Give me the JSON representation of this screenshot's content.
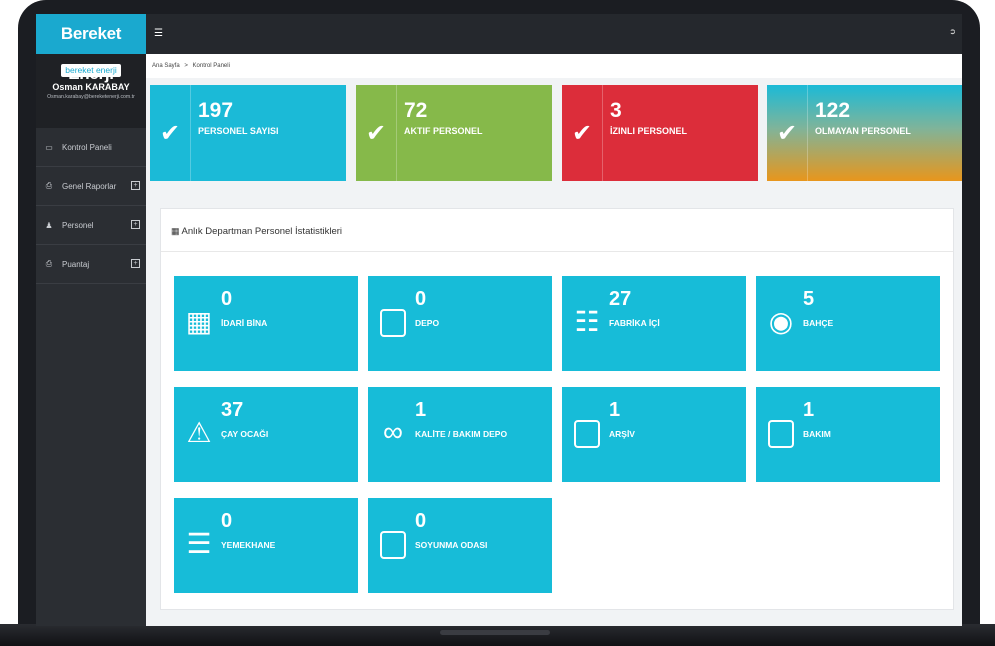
{
  "app": {
    "brand": "Bereket Enerji",
    "logo_text": "bereket enerji"
  },
  "user": {
    "name": "Osman KARABAY",
    "email": "Osman.karabay@bereketenerji.com.tr"
  },
  "sidebar": {
    "items": [
      {
        "label": "Kontrol Paneli",
        "icon": "monitor-icon",
        "expandable": false
      },
      {
        "label": "Genel Raporlar",
        "icon": "print-icon",
        "expandable": true
      },
      {
        "label": "Personel",
        "icon": "user-icon",
        "expandable": true
      },
      {
        "label": "Puantaj",
        "icon": "print-icon",
        "expandable": true
      }
    ]
  },
  "topbar": {
    "menu_icon": "hamburger-icon",
    "logout_icon": "logout-icon"
  },
  "breadcrumb": {
    "home": "Ana Sayfa",
    "separator": ">",
    "current": "Kontrol Paneli"
  },
  "stats": [
    {
      "value": "197",
      "label": "PERSONEL SAYISI",
      "color": "#1bbad7",
      "icon": "broken-link-icon"
    },
    {
      "value": "72",
      "label": "AKTIF PERSONEL",
      "color": "#86b94a",
      "icon": "broken-link-icon"
    },
    {
      "value": "3",
      "label": "İZINLI PERSONEL",
      "color": "#dc2d3a",
      "icon": "broken-link-icon"
    },
    {
      "value": "122",
      "label": "OLMAYAN PERSONEL",
      "color": "#e8961c",
      "icon": "broken-link-icon"
    }
  ],
  "panel": {
    "title": "Anlık Departman Personel İstatistikleri",
    "title_icon": "building-icon"
  },
  "departments": [
    {
      "value": "0",
      "label": "İDARİ BİNA",
      "icon": "building-icon"
    },
    {
      "value": "0",
      "label": "DEPO",
      "icon": "box-icon"
    },
    {
      "value": "27",
      "label": "FABRİKA İÇİ",
      "icon": "calendar-icon"
    },
    {
      "value": "5",
      "label": "BAHÇE",
      "icon": "globe-icon"
    },
    {
      "value": "37",
      "label": "ÇAY OCAĞI",
      "icon": "warning-icon"
    },
    {
      "value": "1",
      "label": "KALİTE / BAKIM DEPO",
      "icon": "link-icon"
    },
    {
      "value": "1",
      "label": "ARŞİV",
      "icon": "box-icon"
    },
    {
      "value": "1",
      "label": "BAKIM",
      "icon": "box-icon"
    },
    {
      "value": "0",
      "label": "YEMEKHANE",
      "icon": "cutlery-icon"
    },
    {
      "value": "0",
      "label": "SOYUNMA ODASI",
      "icon": "box-icon"
    }
  ]
}
